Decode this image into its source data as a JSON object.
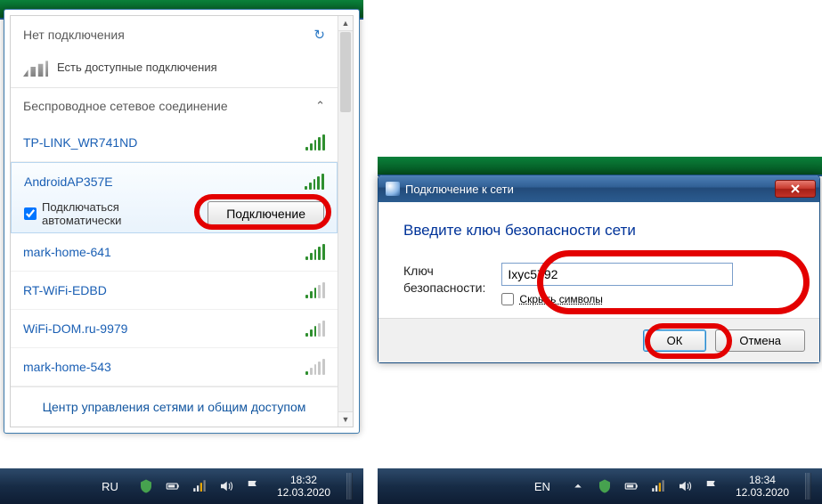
{
  "flyout": {
    "header": "Нет подключения",
    "sub": "Есть доступные подключения",
    "section": "Беспроводное сетевое соединение",
    "footer_link": "Центр управления сетями и общим доступом",
    "networks": [
      {
        "name": "TP-LINK_WR741ND",
        "strength": "full"
      },
      {
        "name": "AndroidAP357E",
        "strength": "full",
        "selected": true
      },
      {
        "name": "mark-home-641",
        "strength": "full"
      },
      {
        "name": "RT-WiFi-EDBD",
        "strength": "med"
      },
      {
        "name": "WiFi-DOM.ru-9979",
        "strength": "med"
      },
      {
        "name": "mark-home-543",
        "strength": "weak"
      }
    ],
    "auto_label_line1": "Подключаться",
    "auto_label_line2": "автоматически",
    "auto_checked": true,
    "connect_label": "Подключение"
  },
  "taskbar_left": {
    "lang": "RU",
    "time": "18:32",
    "date": "12.03.2020"
  },
  "taskbar_right": {
    "lang": "EN",
    "time": "18:34",
    "date": "12.03.2020"
  },
  "dialog": {
    "title": "Подключение к сети",
    "heading": "Введите ключ безопасности сети",
    "key_label_line1": "Ключ",
    "key_label_line2": "безопасности:",
    "key_value": "Ixyc5792",
    "hide_label": "Скрыть символы",
    "hide_checked": false,
    "ok_label": "ОК",
    "cancel_label": "Отмена"
  }
}
